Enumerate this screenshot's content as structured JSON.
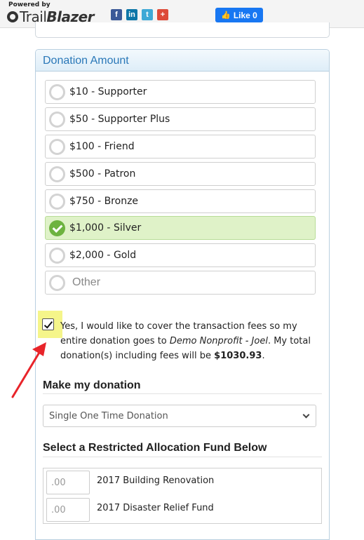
{
  "header": {
    "powered_by": "Powered by",
    "brand_trail": "Trail",
    "brand_blazer": "Blazer",
    "social_icons": [
      "facebook-icon",
      "linkedin-icon",
      "twitter-icon",
      "google-plus-icon"
    ],
    "social_glyphs": [
      "f",
      "in",
      "t",
      "+"
    ],
    "like_label": "Like 0",
    "like_color": "#1877f2"
  },
  "donation": {
    "title": "Donation Amount",
    "options": [
      {
        "label": "$10 - Supporter",
        "selected": false
      },
      {
        "label": "$50 - Supporter Plus",
        "selected": false
      },
      {
        "label": "$100 - Friend",
        "selected": false
      },
      {
        "label": "$500 - Patron",
        "selected": false
      },
      {
        "label": "$750 - Bronze",
        "selected": false
      },
      {
        "label": "$1,000 - Silver",
        "selected": true
      },
      {
        "label": "$2,000 - Gold",
        "selected": false
      }
    ],
    "other_placeholder": "Other",
    "selected_color": "#dff2c8",
    "check_color": "#6db33f"
  },
  "fees": {
    "checked": true,
    "text_before": "Yes, I would like to cover the transaction fees so my entire donation goes to ",
    "org_name": "Demo Nonprofit - Joel",
    "text_mid": ". My total donation(s) including fees will be ",
    "total": "$1030.93",
    "text_end": "."
  },
  "make_donation": {
    "title": "Make my donation",
    "frequency": "Single One Time Donation"
  },
  "funds": {
    "title": "Select a Restricted Allocation Fund Below",
    "items": [
      {
        "amount": ".00",
        "label": "2017 Building Renovation"
      },
      {
        "amount": ".00",
        "label": "2017 Disaster Relief Fund"
      }
    ]
  }
}
